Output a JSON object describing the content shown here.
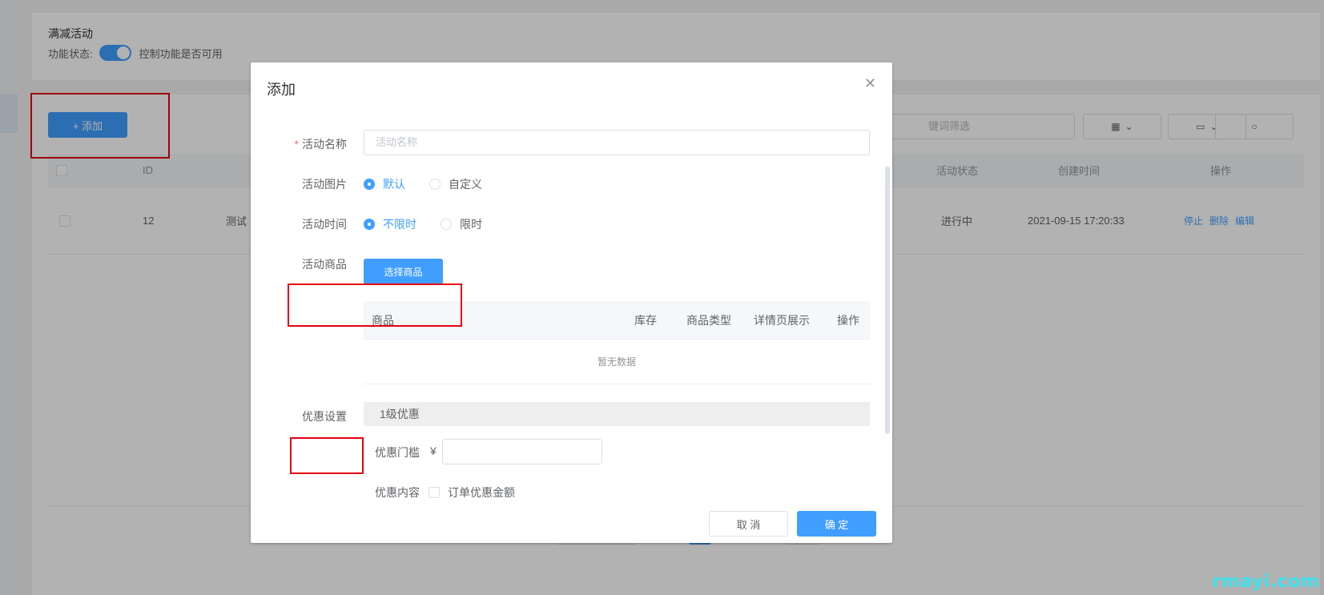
{
  "background": {
    "section_title": "满减活动",
    "status_label": "功能状态:",
    "switch_hint": "控制功能是否可用",
    "add_button": "+ 添加",
    "search_placeholder": "键词筛选",
    "table": {
      "columns": [
        "ID",
        "活动状态",
        "创建时间",
        "操作"
      ],
      "rows": [
        {
          "id": "12",
          "name": "测试",
          "status": "进行中",
          "created": "2021-09-15 17:20:33",
          "ops": [
            "停止",
            "删除",
            "编辑"
          ]
        }
      ]
    }
  },
  "dialog": {
    "title": "添加",
    "close_icon": "close-icon",
    "fields": {
      "name_label": "活动名称",
      "name_placeholder": "活动名称",
      "image_label": "活动图片",
      "image_options": [
        "默认",
        "自定义"
      ],
      "time_label": "活动时间",
      "time_options": [
        "不限时",
        "限时"
      ],
      "goods_label": "活动商品",
      "select_goods_button": "选择商品",
      "goods_columns": [
        "商品",
        "库存",
        "商品类型",
        "详情页展示",
        "操作"
      ],
      "empty_text": "暂无数据",
      "discount_label": "优惠设置",
      "level_title": "1级优惠",
      "threshold_label": "优惠门槛",
      "currency": "¥",
      "content_label": "优惠内容",
      "content_option": "订单优惠金额"
    },
    "cancel_button": "取 消",
    "confirm_button": "确 定"
  },
  "watermark": "rmayi.com",
  "colors": {
    "primary": "#409eff",
    "highlight": "#e60012",
    "watermark": "#3fe3f0"
  }
}
